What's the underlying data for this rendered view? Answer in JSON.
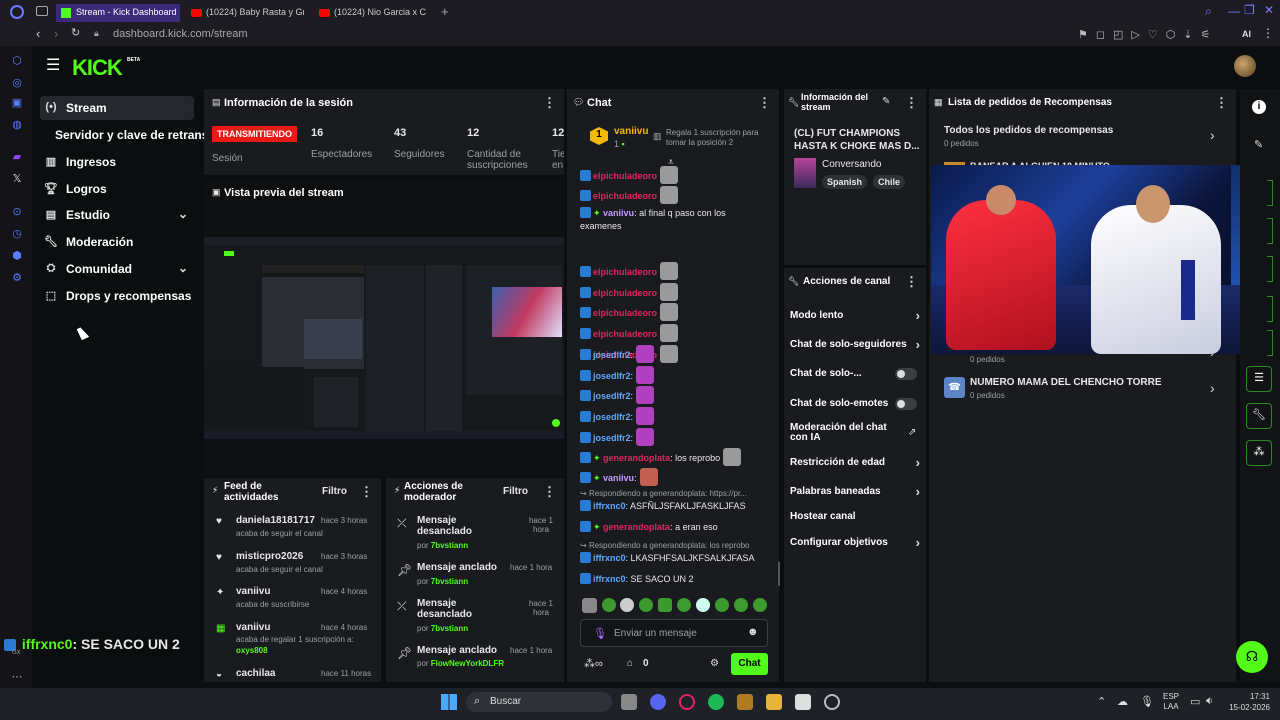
{
  "browser": {
    "tabs": [
      {
        "label": "Stream - Kick Dashboard"
      },
      {
        "label": "(10224) Baby Rasta y Gringo"
      },
      {
        "label": "(10224) Nio Garcia x C"
      }
    ],
    "url": "dashboard.kick.com/stream",
    "extension_label": "AI"
  },
  "brand": {
    "logo": "KICK",
    "beta": "BETA"
  },
  "sidebar": {
    "items": [
      {
        "label": "Stream",
        "icon": "stream-icon"
      },
      {
        "label": "Servidor y clave de retransmisión"
      },
      {
        "label": "Ingresos",
        "icon": "revenue-icon"
      },
      {
        "label": "Logros",
        "icon": "trophy-icon"
      },
      {
        "label": "Estudio",
        "icon": "studio-icon"
      },
      {
        "label": "Moderación",
        "icon": "wrench-icon"
      },
      {
        "label": "Comunidad",
        "icon": "community-icon"
      },
      {
        "label": "Drops y recompensas",
        "icon": "drops-icon"
      }
    ]
  },
  "session": {
    "title": "Información de la sesión",
    "live_badge": "TRANSMITIENDO",
    "session_label": "Sesión",
    "stats": [
      {
        "value": "16",
        "label": "Espectadores"
      },
      {
        "value": "43",
        "label": "Seguidores"
      },
      {
        "value": "12",
        "label": "Cantidad de suscripciones"
      },
      {
        "value": "12",
        "label": "Tie en"
      }
    ]
  },
  "preview": {
    "title": "Vista previa del stream"
  },
  "overlay_chat": {
    "user": "iffrxnc0",
    "text": ": SE SACO UN 2",
    "sub": "GX"
  },
  "activity": {
    "title": "Feed de actividades",
    "filter": "Filtro",
    "items": [
      {
        "user": "daniela18181717",
        "time": "hace 3 horas",
        "desc": "acaba de seguir el canal",
        "highlight": ""
      },
      {
        "user": "misticpro2026",
        "time": "hace 3 horas",
        "desc": "acaba de seguir el canal",
        "highlight": ""
      },
      {
        "user": "vaniivu",
        "time": "hace 4 horas",
        "desc": "acaba de suscribirse",
        "highlight": ""
      },
      {
        "user": "vaniivu",
        "time": "hace 4 horas",
        "desc": "acaba de regalar 1 suscripción a:",
        "highlight": "oxys808"
      },
      {
        "user": "cachilaa",
        "time": "hace 11 horas",
        "desc": "",
        "highlight": ""
      }
    ]
  },
  "modactions": {
    "title": "Acciones de moderador",
    "filter": "Filtro",
    "items": [
      {
        "action": "Mensaje desanclado",
        "by": "por",
        "user": "7bvstiann",
        "time": "hace 1 hora"
      },
      {
        "action": "Mensaje anclado",
        "by": "por",
        "user": "7bvstiann",
        "time": "hace 1 hora"
      },
      {
        "action": "Mensaje desanclado",
        "by": "por",
        "user": "7bvstiann",
        "time": "hace 1 hora"
      },
      {
        "action": "Mensaje anclado",
        "by": "por",
        "user": "FlowNewYorkDLFR",
        "time": "hace 1 hora"
      }
    ]
  },
  "chat": {
    "title": "Chat",
    "pinned_user": "vaniivu",
    "pinned_rank": "1",
    "pinned_count": "1",
    "gift_note": "Regala 1 suscripción para tomar la posición 2",
    "messages": [
      {
        "user": "elpichuladeoro",
        "text": "",
        "color": "#e0245e"
      },
      {
        "user": "elpichuladeoro",
        "text": "",
        "color": "#e0245e"
      },
      {
        "user": "vaniivu",
        "text": ": al final q paso con los",
        "text2": "examenes",
        "color": "#c39bff"
      },
      {
        "user": "elpichuladeoro",
        "text": "",
        "color": "#e0245e"
      },
      {
        "user": "elpichuladeoro",
        "text": "",
        "color": "#e0245e"
      },
      {
        "user": "elpichuladeoro",
        "text": "",
        "color": "#e0245e"
      },
      {
        "user": "elpichuladeoro",
        "text": "",
        "color": "#e0245e"
      },
      {
        "user": "elpichuladeoro",
        "text": "",
        "color": "#e0245e"
      },
      {
        "user": "josedlfr2",
        "text": ":",
        "color": "#5fa8ff"
      },
      {
        "user": "josedlfr2",
        "text": ":",
        "color": "#5fa8ff"
      },
      {
        "user": "josedlfr2",
        "text": ":",
        "color": "#5fa8ff"
      },
      {
        "user": "josedlfr2",
        "text": ":",
        "color": "#5fa8ff"
      },
      {
        "user": "josedlfr2",
        "text": ":",
        "color": "#5fa8ff"
      },
      {
        "user": "generandoplata",
        "text": ": los reprobo",
        "color": "#e0245e"
      },
      {
        "user": "vaniivu",
        "text": ":",
        "color": "#c39bff"
      }
    ],
    "reply1": "Respondiendo a generandoplata: https://pr...",
    "msg_a_user": "iffrxnc0",
    "msg_a_text": ": ASFÑLJSFAKLJFASKLJFAS",
    "msg_b_user": "generandoplata",
    "msg_b_text": ": a eran eso",
    "reply2": "Respondiendo a generandoplata: los reprobo",
    "msg_c_user": "iffrxnc0",
    "msg_c_text": ": LKASFHFSALJKFSALKJFASA",
    "msg_d_user": "iffrxnc0",
    "msg_d_text": ": SE SACO UN 2",
    "input_placeholder": "Enviar un mensaje",
    "points": "0",
    "send": "Chat"
  },
  "streaminfo": {
    "title": "Información del stream",
    "stream_title": "(CL) FUT CHAMPIONS HASTA K CHOKE MAS D...",
    "category": "Conversando",
    "tags": [
      "Spanish",
      "Chile"
    ]
  },
  "channel_actions": {
    "title": "Acciones de canal",
    "items": [
      {
        "label": "Modo lento",
        "kind": "chevron"
      },
      {
        "label": "Chat de solo-seguidores",
        "kind": "chevron"
      },
      {
        "label": "Chat de solo-...",
        "kind": "toggle"
      },
      {
        "label": "Chat de solo-emotes",
        "kind": "toggle"
      },
      {
        "label": "Moderación del chat con IA",
        "kind": "link"
      },
      {
        "label": "Restricción de edad",
        "kind": "chevron"
      },
      {
        "label": "Palabras baneadas",
        "kind": "chevron"
      },
      {
        "label": "Hostear canal",
        "kind": "none"
      },
      {
        "label": "Configurar objetivos",
        "kind": "chevron"
      }
    ]
  },
  "rewards": {
    "title": "Lista de pedidos de Recompensas",
    "all_label": "Todos los pedidos de recompensas",
    "all_count": "0 pedidos",
    "partial_title": "BANEAR A ALGUIEN 10 MINUTO",
    "item1_count": "0 pedidos",
    "item2_title": "NUMERO MAMA DEL CHENCHO TORRE",
    "item2_count": "0 pedidos"
  },
  "taskbar": {
    "search": "Buscar",
    "lang": "ESP",
    "lang2": "LAA",
    "time": "17:31",
    "date": "15-02-2026"
  },
  "colors": {
    "accent": "#53fc18",
    "live": "#e91916",
    "panel": "#191b1f",
    "bg": "#0b0e0f"
  }
}
